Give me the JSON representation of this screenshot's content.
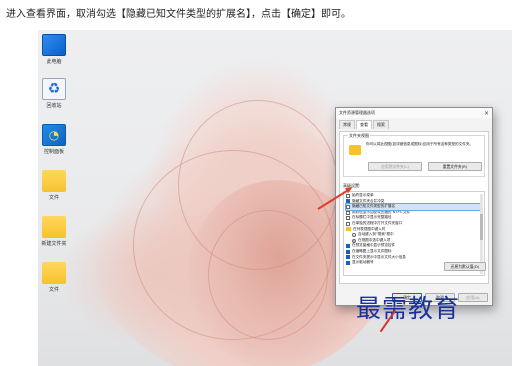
{
  "caption": "进入查看界面，取消勾选【隐藏已知文件类型的扩展名】，点击【确定】即可。",
  "desktop": {
    "icons": [
      {
        "label": "此电脑",
        "icon": "monitor-icon"
      },
      {
        "label": "回收站",
        "icon": "recycle-bin-icon"
      },
      {
        "label": "控制面板",
        "icon": "control-panel-icon"
      },
      {
        "label": "文件",
        "icon": "folder-icon"
      },
      {
        "label": "新建文件夹",
        "icon": "folder-icon"
      },
      {
        "label": "文件",
        "icon": "folder-icon"
      }
    ]
  },
  "dialog": {
    "title": "文件资源管理器选项",
    "tabs": [
      "常规",
      "查看",
      "搜索"
    ],
    "active_tab": "查看",
    "folder_view": {
      "group_title": "文件夹视图",
      "description": "你可以将此视图(如详细信息或图标)应用于所有这种类型的文件夹。",
      "apply_button": "应用到文件夹(L)",
      "reset_button": "重置文件夹(R)"
    },
    "advanced_title": "高级设置:",
    "settings": [
      {
        "type": "checkbox",
        "label": "始终显示菜单",
        "checked": false
      },
      {
        "type": "checkbox",
        "label": "隐藏文件夹合并冲突",
        "checked": true
      },
      {
        "type": "checkbox",
        "label": "隐藏已知文件类型的扩展名",
        "checked": false,
        "highlight": true
      },
      {
        "type": "checkbox",
        "label": "用彩色显示加密或压缩的 NTFS 文件",
        "checked": false
      },
      {
        "type": "checkbox",
        "label": "在标题栏中显示完整路径",
        "checked": false
      },
      {
        "type": "checkbox",
        "label": "在单独的进程中打开文件夹窗口",
        "checked": false
      },
      {
        "type": "folder",
        "label": "在列表视图中键入时"
      },
      {
        "type": "radio",
        "label": "自动键入到\"搜索\"框中",
        "checked": false,
        "indent": true
      },
      {
        "type": "radio",
        "label": "在视图中选中键入项",
        "checked": true,
        "indent": true
      },
      {
        "type": "checkbox",
        "label": "在预览窗格中显示预览控件",
        "checked": true
      },
      {
        "type": "checkbox",
        "label": "在缩略图上显示文件图标",
        "checked": true
      },
      {
        "type": "checkbox",
        "label": "在文件夹提示中显示文件大小信息",
        "checked": true
      },
      {
        "type": "checkbox",
        "label": "显示驱动器号",
        "checked": true
      }
    ],
    "restore_defaults_button": "还原为默认值(D)",
    "ok_button": "确定",
    "cancel_button": "取消",
    "apply_button": "应用(A)"
  },
  "watermark": "最需教育",
  "colors": {
    "accent": "#1a5fc2",
    "arrow": "#e23b2b",
    "watermark": "#1b2f9e"
  }
}
